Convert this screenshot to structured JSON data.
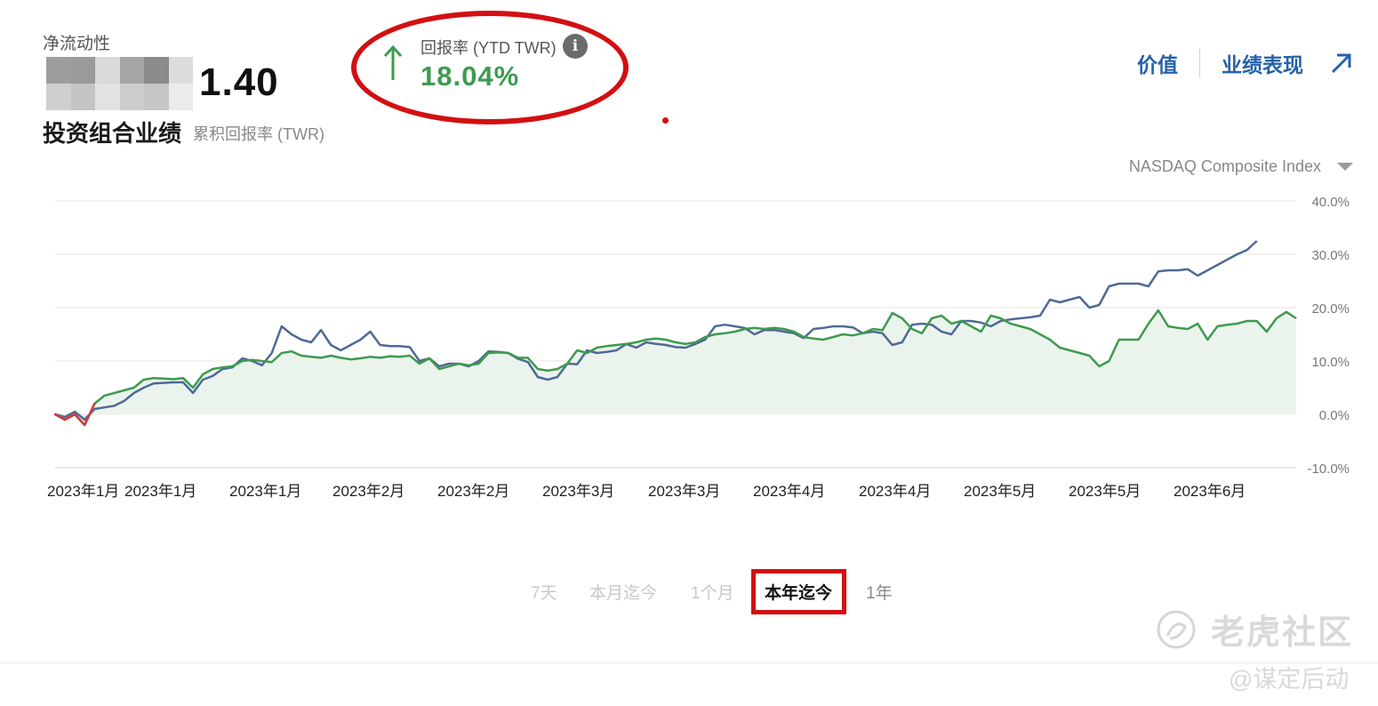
{
  "header": {
    "net_liquidity_label": "净流动性",
    "net_liquidity_visible_suffix": "1.40",
    "portfolio_title": "投资组合业绩",
    "portfolio_subtitle": "累积回报率 (TWR)"
  },
  "return_summary": {
    "label": "回报率 (YTD TWR)",
    "value": "18.04%",
    "direction": "up",
    "info_icon": "info-icon",
    "color": "#3e9a4f"
  },
  "nav": {
    "value_link": "价值",
    "performance_link": "业绩表现",
    "external_icon": "external-link-icon"
  },
  "benchmark": {
    "selected": "NASDAQ Composite Index"
  },
  "chart_data": {
    "type": "line",
    "y_tick_labels": [
      "40.0%",
      "30.0%",
      "20.0%",
      "10.0%",
      "0.0%",
      "-10.0%"
    ],
    "ylim": [
      -10,
      40
    ],
    "x_tick_labels": [
      "2023年1月",
      "2023年1月",
      "2023年1月",
      "2023年2月",
      "2023年2月",
      "2023年3月",
      "2023年3月",
      "2023年4月",
      "2023年4月",
      "2023年5月",
      "2023年5月",
      "2023年6月"
    ],
    "grid": true,
    "series": [
      {
        "name": "",
        "role": "portfolio",
        "color": "#3e9a4f",
        "fill": "#ebf4ec",
        "values": [
          0,
          -1,
          0,
          -2,
          2,
          3.5,
          4,
          4.5,
          5,
          6.5,
          6.8,
          6.7,
          6.6,
          6.8,
          5,
          7.5,
          8.5,
          8.8,
          9,
          10,
          10.2,
          10,
          9.8,
          11.5,
          11.8,
          11,
          10.8,
          10.6,
          11,
          10.6,
          10.3,
          10.5,
          10.8,
          10.6,
          10.9,
          10.8,
          11,
          9.5,
          10.5,
          8.5,
          9,
          9.5,
          9.2,
          9.5,
          11.5,
          11.6,
          11.5,
          10.6,
          10.6,
          8.5,
          8.2,
          8.5,
          9.5,
          12,
          11.5,
          12.5,
          12.8,
          13,
          13.2,
          13.5,
          14,
          14.2,
          14,
          13.5,
          13.2,
          13.5,
          14.5,
          15,
          15.2,
          15.5,
          16,
          16.2,
          16,
          16.2,
          16,
          15.5,
          14.5,
          14.2,
          14,
          14.5,
          15,
          14.8,
          15.2,
          16,
          15.8,
          19,
          18,
          16,
          15.2,
          18,
          18.5,
          17,
          17.5,
          16.5,
          15.5,
          18.5,
          18,
          17,
          16.5,
          16,
          15,
          14,
          12.5,
          12,
          11.5,
          11,
          9,
          10,
          14,
          14,
          14,
          17,
          19.5,
          16.5,
          16.2,
          16,
          17,
          14,
          16.5,
          16.8,
          17,
          17.5,
          17.5,
          15.5,
          18,
          19.2,
          18
        ]
      },
      {
        "name": "NASDAQ Composite Index",
        "role": "benchmark",
        "color": "#4e6a96",
        "values": [
          0,
          -0.5,
          0.5,
          -1,
          1,
          1.3,
          1.6,
          2.5,
          4,
          5,
          5.8,
          5.9,
          6,
          6,
          4,
          6.5,
          7.2,
          8.5,
          8.8,
          10.5,
          10,
          9.2,
          11.5,
          16.5,
          15,
          14,
          13.5,
          15.8,
          13,
          12,
          13,
          14,
          15.5,
          13,
          12.8,
          12.8,
          12.6,
          10,
          10.5,
          9,
          9.5,
          9.5,
          9,
          10,
          11.8,
          11.7,
          11.5,
          10.4,
          9.8,
          7,
          6.5,
          7,
          9.5,
          9.4,
          12,
          11.5,
          11.7,
          12,
          13.2,
          12.5,
          13.5,
          13.2,
          13,
          12.6,
          12.5,
          13.2,
          14,
          16.5,
          16.8,
          16.5,
          16.2,
          15,
          15.8,
          15.8,
          15.5,
          15.2,
          14.3,
          16,
          16.2,
          16.5,
          16.5,
          16.3,
          15.2,
          15.5,
          15.2,
          13,
          13.5,
          16.8,
          17,
          16.8,
          15.5,
          15,
          17.5,
          17.5,
          17.2,
          16.5,
          17.5,
          17.8,
          18,
          18.2,
          18.5,
          21.5,
          21,
          21.5,
          22,
          20,
          20.5,
          24,
          24.5,
          24.5,
          24.5,
          24,
          26.8,
          27,
          27,
          27.2,
          26,
          27,
          28,
          29,
          30,
          30.8,
          32.5
        ]
      }
    ]
  },
  "time_range_tabs": [
    {
      "label": "7天",
      "state": "disabled"
    },
    {
      "label": "本月迄今",
      "state": "disabled"
    },
    {
      "label": "1个月",
      "state": "disabled"
    },
    {
      "label": "本年迄今",
      "state": "active"
    },
    {
      "label": "1年",
      "state": "normal"
    }
  ],
  "watermark": {
    "brand": "老虎社区",
    "handle": "@谋定后动"
  }
}
